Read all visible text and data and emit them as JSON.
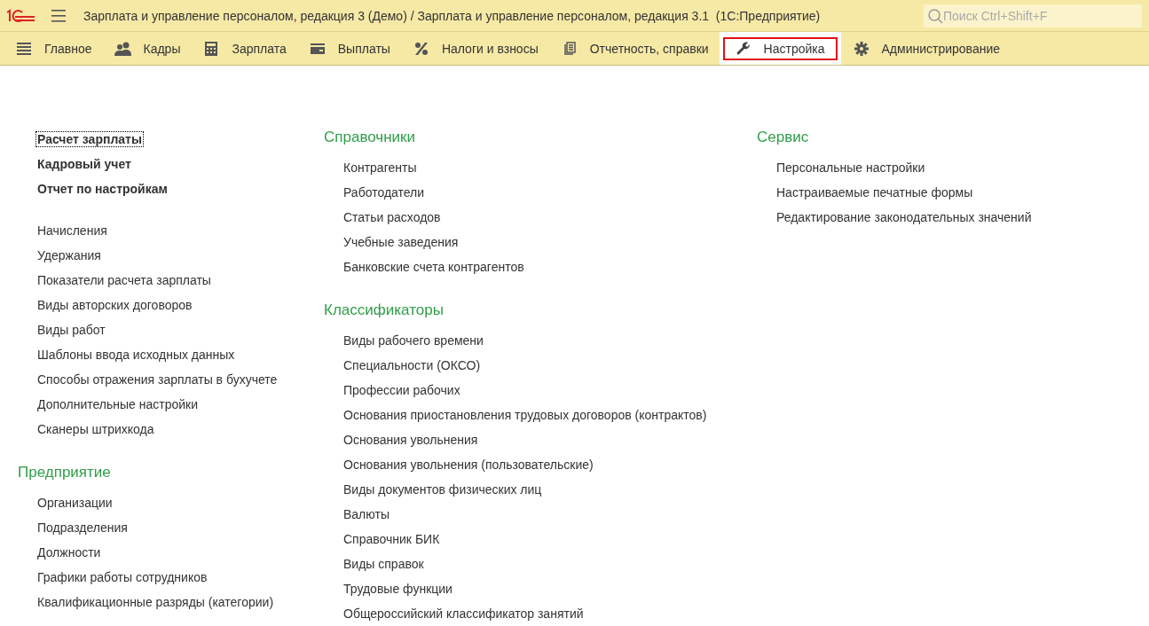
{
  "window": {
    "title": "Зарплата и управление персоналом, редакция 3 (Демо) / Зарплата и управление персоналом, редакция 3.1  (1С:Предприятие)"
  },
  "search": {
    "placeholder": "Поиск Ctrl+Shift+F"
  },
  "sections": [
    {
      "label": "Главное",
      "selected": false
    },
    {
      "label": "Кадры",
      "selected": false
    },
    {
      "label": "Зарплата",
      "selected": false
    },
    {
      "label": "Выплаты",
      "selected": false
    },
    {
      "label": "Налоги и взносы",
      "selected": false
    },
    {
      "label": "Отчетность, справки",
      "selected": false
    },
    {
      "label": "Настройка",
      "selected": true
    },
    {
      "label": "Администрирование",
      "selected": false
    }
  ],
  "columns": [
    [
      {
        "items": [
          {
            "label": "Расчет зарплаты",
            "bold": true,
            "focused": true
          },
          {
            "label": "Кадровый учет",
            "bold": true,
            "focused": false
          },
          {
            "label": "Отчет по настройкам",
            "bold": true,
            "focused": false
          }
        ]
      },
      {
        "items": [
          {
            "label": "Начисления",
            "bold": false,
            "focused": false
          },
          {
            "label": "Удержания",
            "bold": false,
            "focused": false
          },
          {
            "label": "Показатели расчета зарплаты",
            "bold": false,
            "focused": false
          },
          {
            "label": "Виды авторских договоров",
            "bold": false,
            "focused": false
          },
          {
            "label": "Виды работ",
            "bold": false,
            "focused": false
          },
          {
            "label": "Шаблоны ввода исходных данных",
            "bold": false,
            "focused": false
          },
          {
            "label": "Способы отражения зарплаты в бухучете",
            "bold": false,
            "focused": false
          },
          {
            "label": "Дополнительные настройки",
            "bold": false,
            "focused": false
          },
          {
            "label": "Сканеры штрихкода",
            "bold": false,
            "focused": false
          }
        ]
      },
      {
        "title": "Предприятие",
        "items": [
          {
            "label": "Организации",
            "bold": false,
            "focused": false
          },
          {
            "label": "Подразделения",
            "bold": false,
            "focused": false
          },
          {
            "label": "Должности",
            "bold": false,
            "focused": false
          },
          {
            "label": "Графики работы сотрудников",
            "bold": false,
            "focused": false
          },
          {
            "label": "Квалификационные разряды (категории)",
            "bold": false,
            "focused": false
          }
        ]
      }
    ],
    [
      {
        "title": "Справочники",
        "items": [
          {
            "label": "Контрагенты",
            "bold": false,
            "focused": false
          },
          {
            "label": "Работодатели",
            "bold": false,
            "focused": false
          },
          {
            "label": "Статьи расходов",
            "bold": false,
            "focused": false
          },
          {
            "label": "Учебные заведения",
            "bold": false,
            "focused": false
          },
          {
            "label": "Банковские счета контрагентов",
            "bold": false,
            "focused": false
          }
        ]
      },
      {
        "title": "Классификаторы",
        "items": [
          {
            "label": "Виды рабочего времени",
            "bold": false,
            "focused": false
          },
          {
            "label": "Специальности (ОКСО)",
            "bold": false,
            "focused": false
          },
          {
            "label": "Профессии рабочих",
            "bold": false,
            "focused": false
          },
          {
            "label": "Основания приостановления трудовых договоров (контрактов)",
            "bold": false,
            "focused": false
          },
          {
            "label": "Основания увольнения",
            "bold": false,
            "focused": false
          },
          {
            "label": "Основания увольнения (пользовательские)",
            "bold": false,
            "focused": false
          },
          {
            "label": "Виды документов физических лиц",
            "bold": false,
            "focused": false
          },
          {
            "label": "Валюты",
            "bold": false,
            "focused": false
          },
          {
            "label": "Справочник БИК",
            "bold": false,
            "focused": false
          },
          {
            "label": "Виды справок",
            "bold": false,
            "focused": false
          },
          {
            "label": "Трудовые функции",
            "bold": false,
            "focused": false
          },
          {
            "label": "Общероссийский классификатор занятий",
            "bold": false,
            "focused": false
          }
        ]
      }
    ],
    [
      {
        "title": "Сервис",
        "items": [
          {
            "label": "Персональные настройки",
            "bold": false,
            "focused": false
          },
          {
            "label": "Настраиваемые печатные формы",
            "bold": false,
            "focused": false
          },
          {
            "label": "Редактирование законодательных значений",
            "bold": false,
            "focused": false
          }
        ]
      }
    ]
  ]
}
